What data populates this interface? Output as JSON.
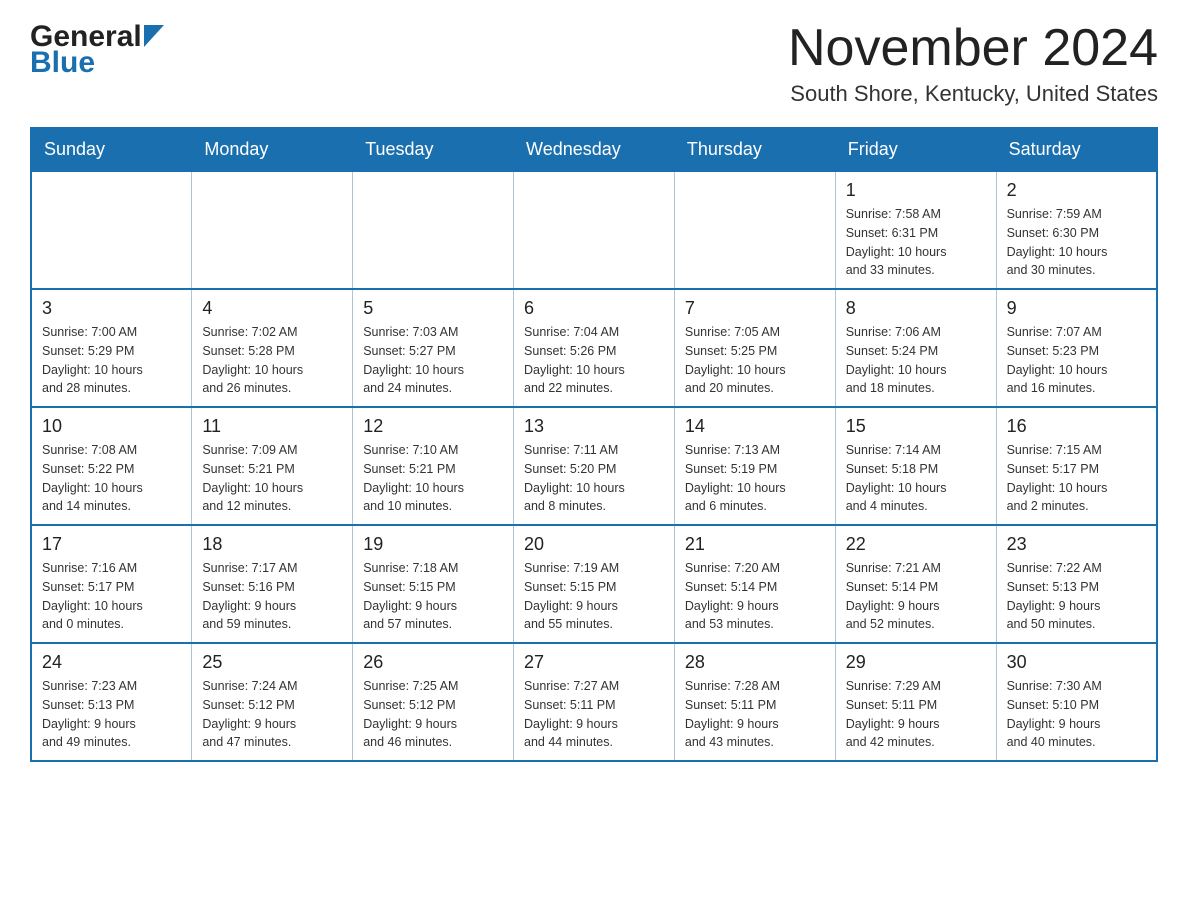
{
  "logo": {
    "general": "General",
    "blue": "Blue",
    "arrow_color": "#1a6faf"
  },
  "header": {
    "month_title": "November 2024",
    "location": "South Shore, Kentucky, United States"
  },
  "weekdays": [
    "Sunday",
    "Monday",
    "Tuesday",
    "Wednesday",
    "Thursday",
    "Friday",
    "Saturday"
  ],
  "weeks": [
    {
      "days": [
        {
          "number": "",
          "info": ""
        },
        {
          "number": "",
          "info": ""
        },
        {
          "number": "",
          "info": ""
        },
        {
          "number": "",
          "info": ""
        },
        {
          "number": "",
          "info": ""
        },
        {
          "number": "1",
          "info": "Sunrise: 7:58 AM\nSunset: 6:31 PM\nDaylight: 10 hours\nand 33 minutes."
        },
        {
          "number": "2",
          "info": "Sunrise: 7:59 AM\nSunset: 6:30 PM\nDaylight: 10 hours\nand 30 minutes."
        }
      ]
    },
    {
      "days": [
        {
          "number": "3",
          "info": "Sunrise: 7:00 AM\nSunset: 5:29 PM\nDaylight: 10 hours\nand 28 minutes."
        },
        {
          "number": "4",
          "info": "Sunrise: 7:02 AM\nSunset: 5:28 PM\nDaylight: 10 hours\nand 26 minutes."
        },
        {
          "number": "5",
          "info": "Sunrise: 7:03 AM\nSunset: 5:27 PM\nDaylight: 10 hours\nand 24 minutes."
        },
        {
          "number": "6",
          "info": "Sunrise: 7:04 AM\nSunset: 5:26 PM\nDaylight: 10 hours\nand 22 minutes."
        },
        {
          "number": "7",
          "info": "Sunrise: 7:05 AM\nSunset: 5:25 PM\nDaylight: 10 hours\nand 20 minutes."
        },
        {
          "number": "8",
          "info": "Sunrise: 7:06 AM\nSunset: 5:24 PM\nDaylight: 10 hours\nand 18 minutes."
        },
        {
          "number": "9",
          "info": "Sunrise: 7:07 AM\nSunset: 5:23 PM\nDaylight: 10 hours\nand 16 minutes."
        }
      ]
    },
    {
      "days": [
        {
          "number": "10",
          "info": "Sunrise: 7:08 AM\nSunset: 5:22 PM\nDaylight: 10 hours\nand 14 minutes."
        },
        {
          "number": "11",
          "info": "Sunrise: 7:09 AM\nSunset: 5:21 PM\nDaylight: 10 hours\nand 12 minutes."
        },
        {
          "number": "12",
          "info": "Sunrise: 7:10 AM\nSunset: 5:21 PM\nDaylight: 10 hours\nand 10 minutes."
        },
        {
          "number": "13",
          "info": "Sunrise: 7:11 AM\nSunset: 5:20 PM\nDaylight: 10 hours\nand 8 minutes."
        },
        {
          "number": "14",
          "info": "Sunrise: 7:13 AM\nSunset: 5:19 PM\nDaylight: 10 hours\nand 6 minutes."
        },
        {
          "number": "15",
          "info": "Sunrise: 7:14 AM\nSunset: 5:18 PM\nDaylight: 10 hours\nand 4 minutes."
        },
        {
          "number": "16",
          "info": "Sunrise: 7:15 AM\nSunset: 5:17 PM\nDaylight: 10 hours\nand 2 minutes."
        }
      ]
    },
    {
      "days": [
        {
          "number": "17",
          "info": "Sunrise: 7:16 AM\nSunset: 5:17 PM\nDaylight: 10 hours\nand 0 minutes."
        },
        {
          "number": "18",
          "info": "Sunrise: 7:17 AM\nSunset: 5:16 PM\nDaylight: 9 hours\nand 59 minutes."
        },
        {
          "number": "19",
          "info": "Sunrise: 7:18 AM\nSunset: 5:15 PM\nDaylight: 9 hours\nand 57 minutes."
        },
        {
          "number": "20",
          "info": "Sunrise: 7:19 AM\nSunset: 5:15 PM\nDaylight: 9 hours\nand 55 minutes."
        },
        {
          "number": "21",
          "info": "Sunrise: 7:20 AM\nSunset: 5:14 PM\nDaylight: 9 hours\nand 53 minutes."
        },
        {
          "number": "22",
          "info": "Sunrise: 7:21 AM\nSunset: 5:14 PM\nDaylight: 9 hours\nand 52 minutes."
        },
        {
          "number": "23",
          "info": "Sunrise: 7:22 AM\nSunset: 5:13 PM\nDaylight: 9 hours\nand 50 minutes."
        }
      ]
    },
    {
      "days": [
        {
          "number": "24",
          "info": "Sunrise: 7:23 AM\nSunset: 5:13 PM\nDaylight: 9 hours\nand 49 minutes."
        },
        {
          "number": "25",
          "info": "Sunrise: 7:24 AM\nSunset: 5:12 PM\nDaylight: 9 hours\nand 47 minutes."
        },
        {
          "number": "26",
          "info": "Sunrise: 7:25 AM\nSunset: 5:12 PM\nDaylight: 9 hours\nand 46 minutes."
        },
        {
          "number": "27",
          "info": "Sunrise: 7:27 AM\nSunset: 5:11 PM\nDaylight: 9 hours\nand 44 minutes."
        },
        {
          "number": "28",
          "info": "Sunrise: 7:28 AM\nSunset: 5:11 PM\nDaylight: 9 hours\nand 43 minutes."
        },
        {
          "number": "29",
          "info": "Sunrise: 7:29 AM\nSunset: 5:11 PM\nDaylight: 9 hours\nand 42 minutes."
        },
        {
          "number": "30",
          "info": "Sunrise: 7:30 AM\nSunset: 5:10 PM\nDaylight: 9 hours\nand 40 minutes."
        }
      ]
    }
  ]
}
